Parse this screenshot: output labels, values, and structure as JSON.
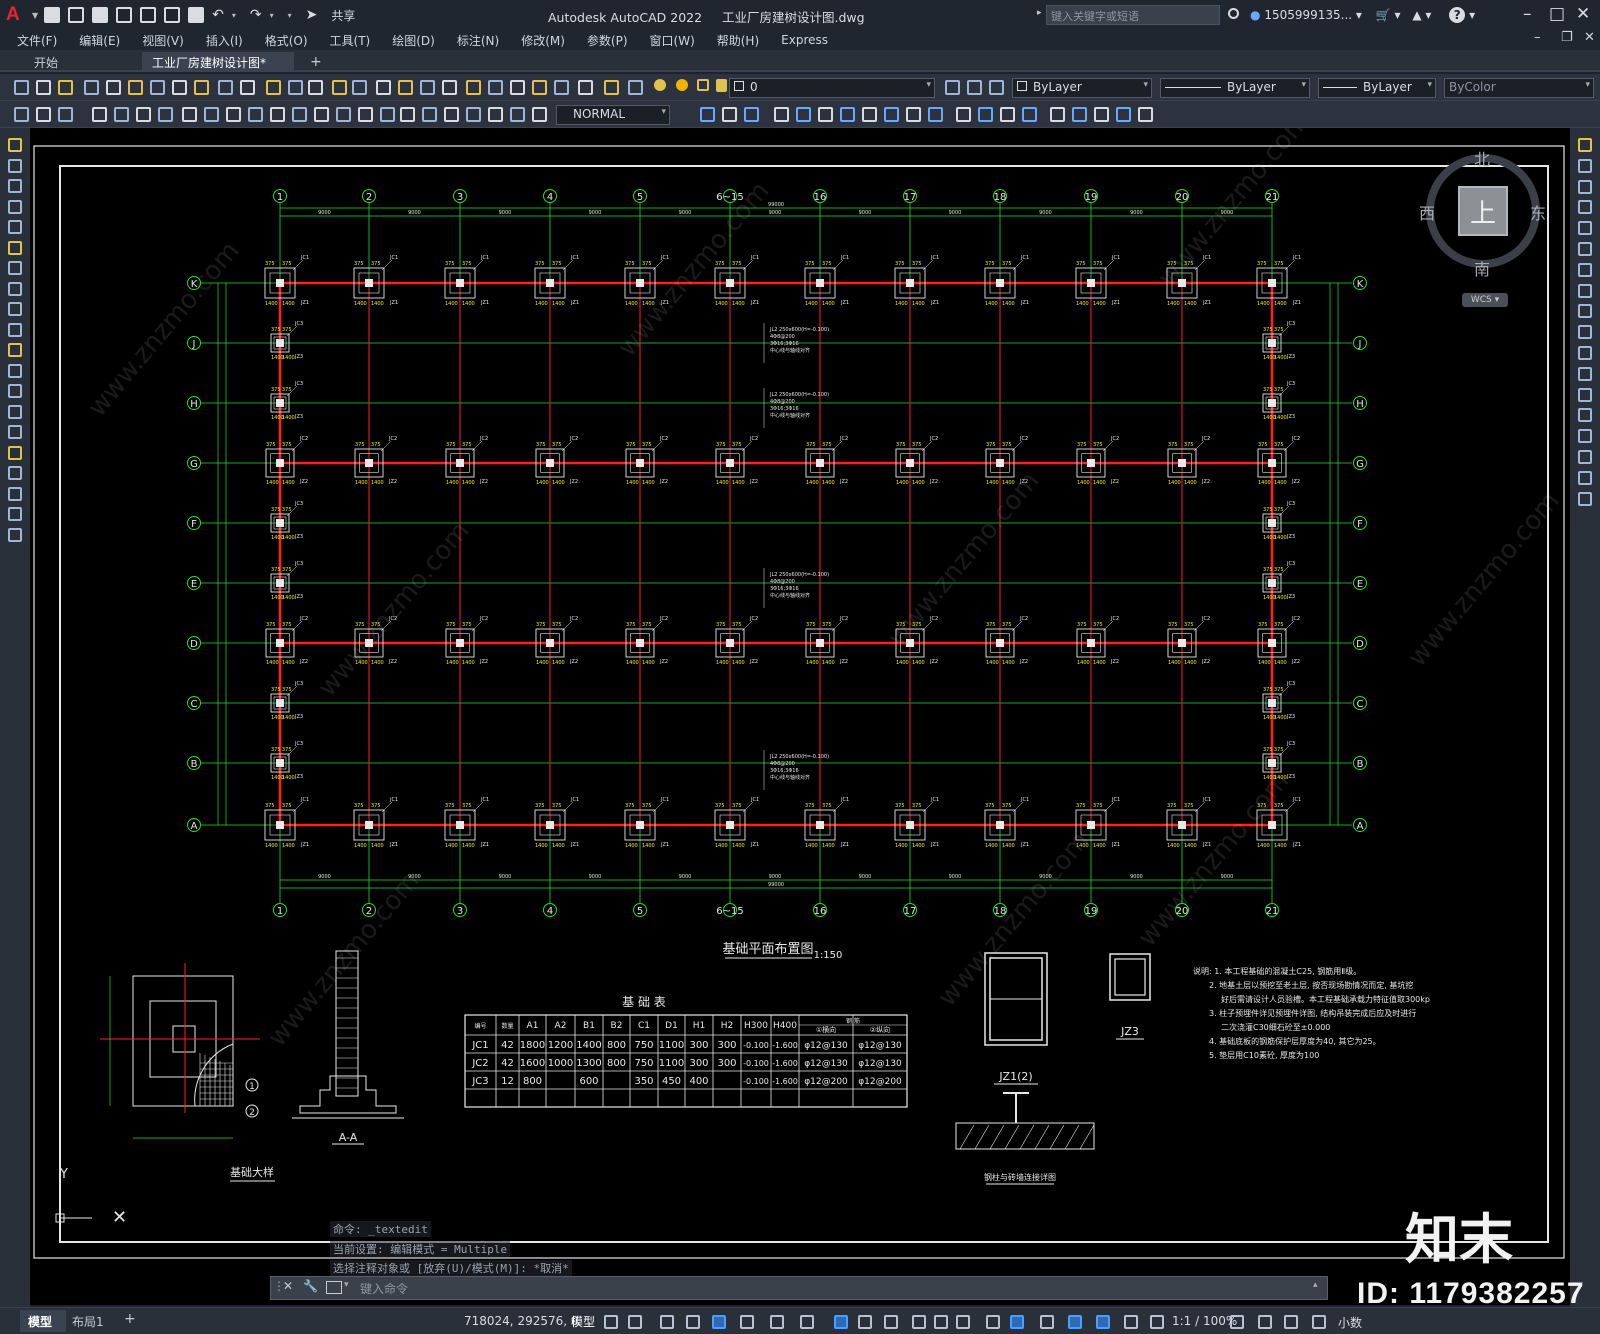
{
  "app": {
    "title": "Autodesk AutoCAD 2022",
    "document": "工业厂房建树设计图.dwg",
    "logo_letter": "A"
  },
  "quick_access": {
    "share_label": "共享"
  },
  "search": {
    "placeholder": "键入关键字或短语"
  },
  "user": {
    "name": "1505999135..."
  },
  "menu": [
    "文件(F)",
    "编辑(E)",
    "视图(V)",
    "插入(I)",
    "格式(O)",
    "工具(T)",
    "绘图(D)",
    "标注(N)",
    "修改(M)",
    "参数(P)",
    "窗口(W)",
    "帮助(H)",
    "Express"
  ],
  "tabs": [
    {
      "label": "开始"
    },
    {
      "label": "工业厂房建树设计图*"
    }
  ],
  "toolbar": {
    "layer_value": "0",
    "text_style": "NORMAL",
    "color": "ByLayer",
    "linetype": "ByLayer",
    "lineweight": "ByLayer",
    "plotstyle": "ByColor"
  },
  "viewcube": {
    "north": "北",
    "south": "南",
    "west": "西",
    "east": "东",
    "top": "上",
    "wcs": "WCS"
  },
  "command": {
    "history": [
      "命令: _textedit",
      "当前设置: 编辑模式 = Multiple",
      "选择注释对象或 [放弃(U)/模式(M)]: *取消*"
    ],
    "placeholder": "键入命令"
  },
  "statusbar": {
    "model_tab": "模型",
    "layout_tab": "布局1",
    "coords": "718024, 292576, 0",
    "space": "模型",
    "scale": "1:1 / 100%",
    "units": "小数"
  },
  "watermark": {
    "logo": "知末",
    "id": "ID: 1179382257",
    "diagonal": "www.znzmo.com"
  },
  "drawing": {
    "grid_cols": [
      "1",
      "2",
      "3",
      "4",
      "5",
      "6~15",
      "16",
      "17",
      "18",
      "19",
      "20",
      "21"
    ],
    "grid_rows": [
      "K",
      "J",
      "H",
      "G",
      "F",
      "E",
      "D",
      "C",
      "B",
      "A"
    ],
    "plan_title": "基础平面布置图",
    "plan_scale": "1:150",
    "total_width": "99000",
    "bay_width": "9000",
    "detail_title": "基础大样",
    "section_label": "A-A",
    "table_title": "基 础 表",
    "table_headers": [
      "编号",
      "数量",
      "A1",
      "A2",
      "B1",
      "B2",
      "C1",
      "D1",
      "H1",
      "H2",
      "H300",
      "H400",
      "①横向",
      "②纵向"
    ],
    "table_rebar_header": "钢 筋",
    "table_rows": [
      [
        "JC1",
        "42",
        "1800",
        "1200",
        "1400",
        "800",
        "750",
        "1100",
        "300",
        "300",
        "-0.100",
        "-1.600",
        "φ12@130",
        "φ12@130"
      ],
      [
        "JC2",
        "42",
        "1600",
        "1000",
        "1300",
        "800",
        "750",
        "1100",
        "300",
        "300",
        "-0.100",
        "-1.600",
        "φ12@130",
        "φ12@130"
      ],
      [
        "JC3",
        "12",
        "800",
        "",
        "600",
        "",
        "350",
        "450",
        "400",
        "",
        "-0.100",
        "-1.600",
        "φ12@200",
        "φ12@200"
      ]
    ],
    "jz1_label": "JZ1(2)",
    "jz3_label": "JZ3",
    "connection_label": "钢柱与砖墙连接详图",
    "notes": [
      "说明: 1. 本工程基础的混凝土C25, 钢筋用Ⅱ级。",
      "2. 地基土层以预挖至老土层, 按否现场勘情况而定, 基坑挖",
      "好后需请设计人员验槽。本工程基础承载力特征值取300kp",
      "3. 柱子预埋件详见预埋件详图, 结构吊装完成后应及时进行",
      "二次浇灌C30细石砼至±0.000",
      "4. 基础底板的钢筋保护层厚度为40, 其它为25。",
      "5. 垫层用C10素砼, 厚度为100"
    ],
    "beam_note": [
      "JL2 250x600(H=-0.100)",
      "4Φ8@200",
      "3Φ16;3Φ16",
      "中心线与轴线对齐"
    ],
    "col_dims": {
      "a": "375",
      "b": "1400",
      "c": "2875"
    },
    "base_labels": {
      "jc1": "JC1",
      "jc2": "JC2",
      "jc3": "JC3",
      "jz1": "JZ1",
      "jz2": "JZ2",
      "jz3": "JZ3"
    }
  }
}
